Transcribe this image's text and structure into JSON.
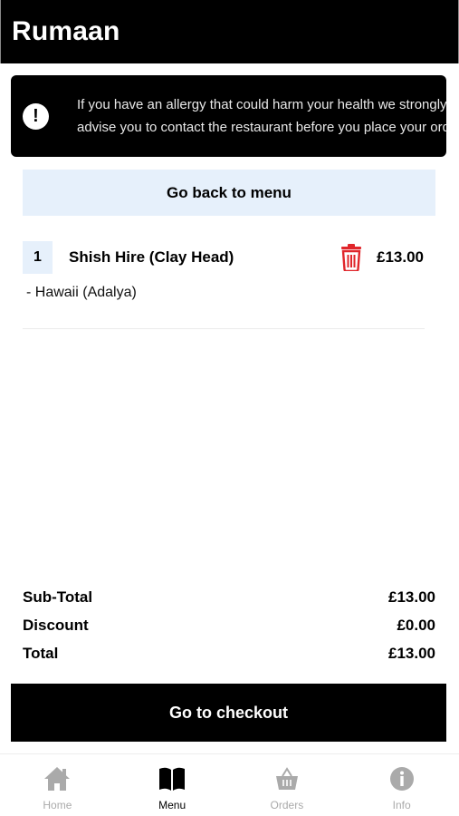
{
  "header": {
    "title": "Rumaan"
  },
  "allergy_notice": {
    "icon": "exclamation-icon",
    "line1": "If you have an allergy that could harm your health we strongly",
    "line2": "advise you to contact the restaurant before you place your order"
  },
  "back_button": {
    "label": "Go back to menu"
  },
  "cart": {
    "items": [
      {
        "quantity": "1",
        "name": "Shish Hire (Clay Head)",
        "option": "- Hawaii (Adalya)",
        "price": "£13.00",
        "delete_icon": "trash-icon"
      }
    ]
  },
  "totals": {
    "subtotal_label": "Sub-Total",
    "subtotal_value": "£13.00",
    "discount_label": "Discount",
    "discount_value": "£0.00",
    "total_label": "Total",
    "total_value": "£13.00"
  },
  "checkout_button": {
    "label": "Go to checkout"
  },
  "nav": {
    "items": [
      {
        "label": "Home",
        "icon": "home-icon",
        "active": false
      },
      {
        "label": "Menu",
        "icon": "book-icon",
        "active": true
      },
      {
        "label": "Orders",
        "icon": "basket-icon",
        "active": false
      },
      {
        "label": "Info",
        "icon": "info-icon",
        "active": false
      }
    ]
  },
  "colors": {
    "accent_light": "#e6f0fb",
    "danger": "#e0262b",
    "dark": "#000000",
    "inactive": "#aaaaaa"
  }
}
